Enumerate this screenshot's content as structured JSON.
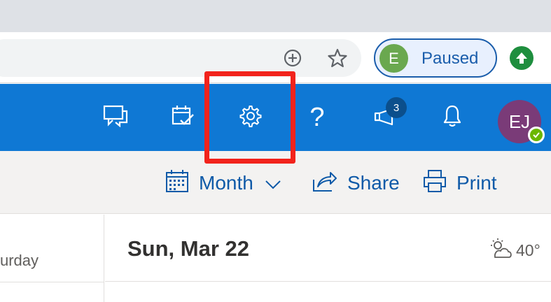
{
  "browser": {
    "profile": {
      "initial": "E",
      "status": "Paused"
    },
    "icons": [
      "add-circle-icon",
      "star-icon",
      "update-arrow-icon"
    ]
  },
  "header": {
    "notifications_count": "3",
    "help_glyph": "?",
    "user_initials": "EJ",
    "icons": [
      "chat-feedback-icon",
      "calendar-check-icon",
      "gear-icon",
      "help-icon",
      "megaphone-icon",
      "bell-icon"
    ],
    "accent_color": "#0f78d4"
  },
  "commands": {
    "view_label": "Month",
    "share_label": "Share",
    "print_label": "Print"
  },
  "calendar": {
    "weekday_fragment": "urday",
    "selected_date": "Sun, Mar 22",
    "temperature": "40°"
  },
  "annotation": {
    "color": "#f2231c"
  }
}
